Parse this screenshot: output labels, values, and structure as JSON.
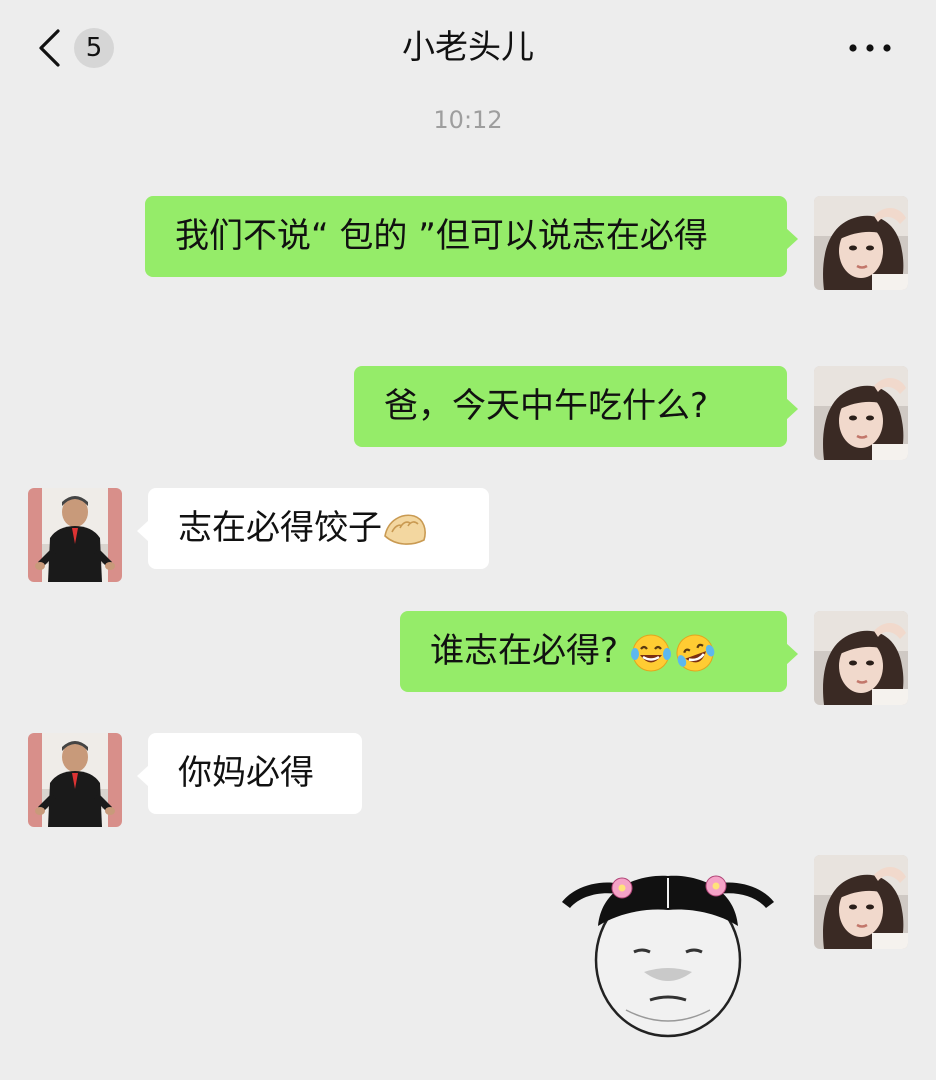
{
  "header": {
    "back_icon": "chevron-left-icon",
    "unread_count": "5",
    "title": "小老头儿",
    "more_icon": "more-dots-icon"
  },
  "chat": {
    "timestamp": "10:12",
    "messages": [
      {
        "side": "right",
        "sender": "self",
        "text": "我们不说“ 包的 ”但可以说志在必得"
      },
      {
        "side": "right",
        "sender": "self",
        "text": "爸，今天中午吃什么?"
      },
      {
        "side": "left",
        "sender": "dad",
        "text": "志在必得饺子",
        "trailing_emoji": "dumpling-emoji"
      },
      {
        "side": "right",
        "sender": "self",
        "text": "谁志在必得? ",
        "trailing_emoji": [
          "tears-of-joy-emoji",
          "crying-laughing-emoji"
        ]
      },
      {
        "side": "left",
        "sender": "dad",
        "text": "你妈必得"
      },
      {
        "side": "right",
        "sender": "self",
        "type": "sticker",
        "sticker": "pigtail-girl-sticker"
      }
    ]
  },
  "colors": {
    "background": "#ededed",
    "self_bubble": "#95ec69",
    "other_bubble": "#ffffff",
    "timestamp": "#9e9e9e"
  }
}
